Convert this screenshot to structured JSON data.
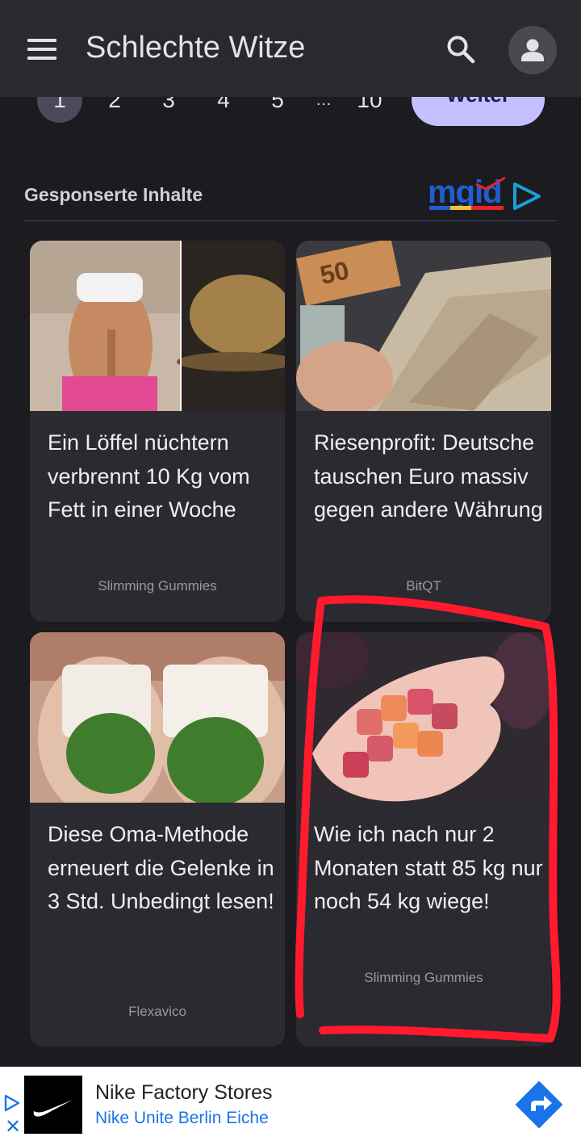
{
  "app_bar": {
    "title": "Schlechte Witze"
  },
  "pagination": {
    "pages": [
      "1",
      "2",
      "3",
      "4",
      "5",
      "…",
      "10"
    ],
    "active_page": "1",
    "next_label": "Weiter"
  },
  "sponsored": {
    "title": "Gesponserte Inhalte",
    "provider_logo": "mgid"
  },
  "cards": [
    {
      "title": "Ein Löffel nüchtern verbrennt 10 Kg vom Fett in einer Woche",
      "source": "Slimming Gummies",
      "image": "fitness-woman-and-powder-photo"
    },
    {
      "title": "Riesenprofit: Deutsche tauschen Euro massiv gegen andere Währung",
      "source": "BitQT",
      "image": "euro-banknotes-photo"
    },
    {
      "title": "Diese Oma-Methode erneuert die Gelenke in 3 Std. Unbedingt lesen!",
      "source": "Flexavico",
      "image": "bandaged-knees-leaves-photo"
    },
    {
      "title": "Wie ich nach nur 2 Monaten statt 85 kg nur noch 54 kg wiege!",
      "source": "Slimming Gummies",
      "image": "gummies-in-hand-photo"
    }
  ],
  "ad_banner": {
    "title": "Nike Factory Stores",
    "subtitle": "Nike Unite Berlin Eiche",
    "logo": "nike-swoosh",
    "cta_icon": "directions-arrow-icon"
  },
  "colors": {
    "background": "#1c1b20",
    "app_bar": "#2a292e",
    "card": "#2b2a30",
    "next_button": "#c4c0ff",
    "highlight": "#ff1a2e",
    "ad_link": "#1a73e8"
  }
}
